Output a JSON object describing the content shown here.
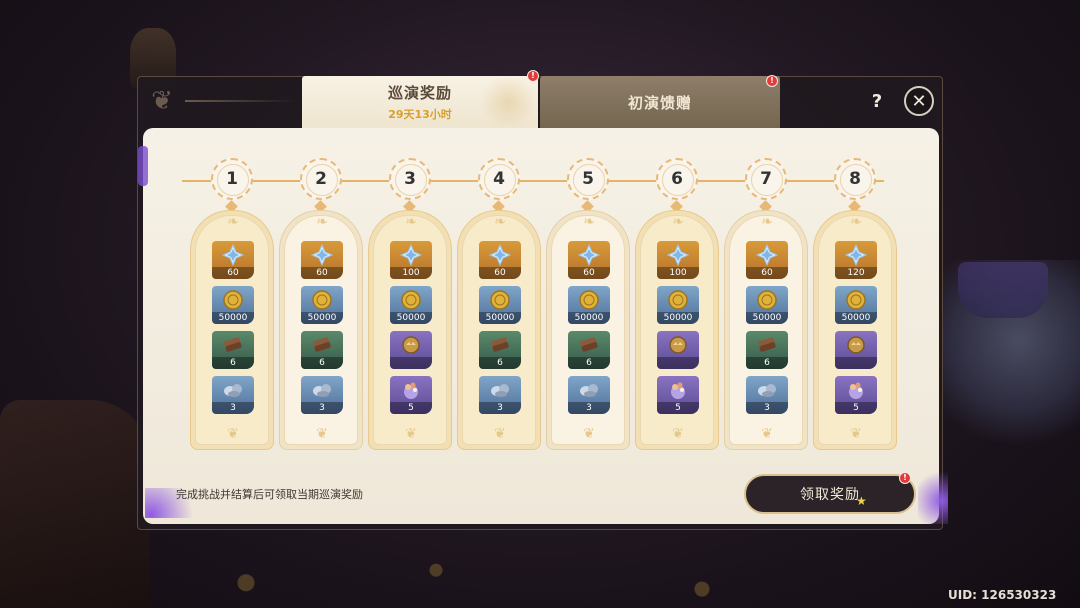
{
  "tabs": {
    "active": {
      "title": "巡演奖励",
      "sub": "29天13小时"
    },
    "inactive": {
      "title": "初演馈赠"
    }
  },
  "buttons": {
    "help": "?",
    "close": "✕",
    "claim": "领取奖励"
  },
  "hint": "完成挑战并结算后可领取当期巡演奖励",
  "uid": "UID: 126530323",
  "colors": {
    "accent": "#e8b877",
    "notification": "#e23a3a",
    "panel": "#f6f1e6"
  },
  "tickets": [
    {
      "num": "1",
      "state": "claimed",
      "rewards": [
        {
          "icon": "primogem-icon",
          "bg": "gold",
          "qty": "60"
        },
        {
          "icon": "mora-icon",
          "bg": "blue",
          "qty": "50000"
        },
        {
          "icon": "scroll-icon",
          "bg": "green",
          "qty": "6"
        },
        {
          "icon": "ore-icon",
          "bg": "blue",
          "qty": "3"
        }
      ]
    },
    {
      "num": "2",
      "state": "pending",
      "rewards": [
        {
          "icon": "primogem-icon",
          "bg": "gold",
          "qty": "60"
        },
        {
          "icon": "mora-icon",
          "bg": "blue",
          "qty": "50000"
        },
        {
          "icon": "scroll-icon",
          "bg": "green",
          "qty": "6"
        },
        {
          "icon": "ore-icon",
          "bg": "blue",
          "qty": "3"
        }
      ]
    },
    {
      "num": "3",
      "state": "claimed",
      "rewards": [
        {
          "icon": "primogem-icon",
          "bg": "gold",
          "qty": "100"
        },
        {
          "icon": "mora-icon",
          "bg": "blue",
          "qty": "50000"
        },
        {
          "icon": "crown-orb-icon",
          "bg": "purple",
          "qty": ""
        },
        {
          "icon": "potion-icon",
          "bg": "purple",
          "qty": "5"
        }
      ]
    },
    {
      "num": "4",
      "state": "claimed",
      "rewards": [
        {
          "icon": "primogem-icon",
          "bg": "gold",
          "qty": "60"
        },
        {
          "icon": "mora-icon",
          "bg": "blue",
          "qty": "50000"
        },
        {
          "icon": "scroll-icon",
          "bg": "green",
          "qty": "6"
        },
        {
          "icon": "ore-icon",
          "bg": "blue",
          "qty": "3"
        }
      ]
    },
    {
      "num": "5",
      "state": "pending",
      "rewards": [
        {
          "icon": "primogem-icon",
          "bg": "gold",
          "qty": "60"
        },
        {
          "icon": "mora-icon",
          "bg": "blue",
          "qty": "50000"
        },
        {
          "icon": "scroll-icon",
          "bg": "green",
          "qty": "6"
        },
        {
          "icon": "ore-icon",
          "bg": "blue",
          "qty": "3"
        }
      ]
    },
    {
      "num": "6",
      "state": "claimed",
      "rewards": [
        {
          "icon": "primogem-icon",
          "bg": "gold",
          "qty": "100"
        },
        {
          "icon": "mora-icon",
          "bg": "blue",
          "qty": "50000"
        },
        {
          "icon": "crown-orb-icon",
          "bg": "purple",
          "qty": ""
        },
        {
          "icon": "potion-icon",
          "bg": "purple",
          "qty": "5"
        }
      ]
    },
    {
      "num": "7",
      "state": "pending",
      "rewards": [
        {
          "icon": "primogem-icon",
          "bg": "gold",
          "qty": "60"
        },
        {
          "icon": "mora-icon",
          "bg": "blue",
          "qty": "50000"
        },
        {
          "icon": "scroll-icon",
          "bg": "green",
          "qty": "6"
        },
        {
          "icon": "ore-icon",
          "bg": "blue",
          "qty": "3"
        }
      ]
    },
    {
      "num": "8",
      "state": "claimed",
      "rewards": [
        {
          "icon": "primogem-icon",
          "bg": "gold",
          "qty": "120"
        },
        {
          "icon": "mora-icon",
          "bg": "blue",
          "qty": "50000"
        },
        {
          "icon": "crown-orb-icon",
          "bg": "purple",
          "qty": ""
        },
        {
          "icon": "potion-icon",
          "bg": "purple",
          "qty": "5"
        }
      ]
    }
  ]
}
